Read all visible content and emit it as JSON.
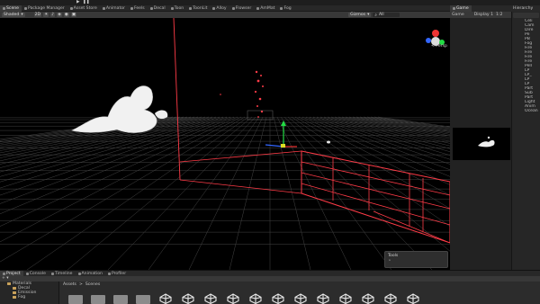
{
  "scene_tabs": [
    {
      "label": "Scene",
      "active": true
    },
    {
      "label": "Package Manager"
    },
    {
      "label": "Asset Store"
    },
    {
      "label": "Animator"
    },
    {
      "label": "Feels"
    },
    {
      "label": "Decal"
    },
    {
      "label": "Toon"
    },
    {
      "label": "ToonLit"
    },
    {
      "label": "Alloy"
    },
    {
      "label": "Flowser"
    },
    {
      "label": "AmMat"
    },
    {
      "label": "Fog"
    }
  ],
  "toolbar": {
    "shading_mode": "Shaded",
    "mode_2d": "2D",
    "gizmos": "Gizmos",
    "search_placeholder": "All"
  },
  "gizmo": {
    "projection": "< Persp"
  },
  "game": {
    "tab_label": "Game",
    "display_label": "Game",
    "display_select": "Display 1",
    "scale": "1:2"
  },
  "hierarchy": {
    "tab_label": "Hierarchy",
    "rows": [
      "Celi",
      "Cam",
      "Dire",
      "Pe",
      "PB",
      "Fog",
      "Fire",
      "Fire",
      "Fire",
      "Fire",
      "Pell",
      "LP",
      "LP_",
      "LP",
      "LP",
      "Part",
      "Sub",
      "Part",
      "Light",
      "Anim",
      "Ocean"
    ]
  },
  "bottom_tabs": [
    {
      "label": "Project",
      "active": true
    },
    {
      "label": "Console"
    },
    {
      "label": "Timeline"
    },
    {
      "label": "Animation"
    },
    {
      "label": "Profiler"
    }
  ],
  "project_tree": [
    "Materials",
    "Decal",
    "Emission",
    "Fog"
  ],
  "breadcrumb": {
    "root": "Assets",
    "sep": ">",
    "folder": "Scenes"
  },
  "assets": [
    {
      "kind": "folder"
    },
    {
      "kind": "folder"
    },
    {
      "kind": "folder"
    },
    {
      "kind": "folder"
    },
    {
      "kind": "unity"
    },
    {
      "kind": "unity"
    },
    {
      "kind": "unity"
    },
    {
      "kind": "unity"
    },
    {
      "kind": "unity"
    },
    {
      "kind": "unity"
    },
    {
      "kind": "unity"
    },
    {
      "kind": "unity"
    },
    {
      "kind": "unity"
    },
    {
      "kind": "unity"
    },
    {
      "kind": "unity"
    },
    {
      "kind": "unity"
    }
  ],
  "tools_overlay": {
    "title": "Tools"
  },
  "colors": {
    "wire_red": "#ff3b47",
    "grid": "#444444",
    "axis_y": "#22dd44",
    "axis_x": "#ee3333",
    "axis_z": "#3366ff"
  }
}
